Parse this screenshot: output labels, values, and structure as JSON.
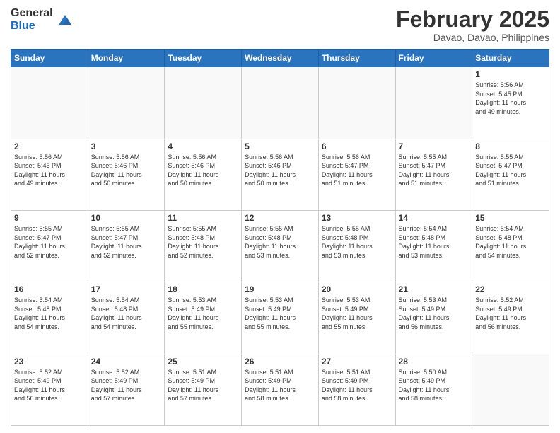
{
  "header": {
    "logo_general": "General",
    "logo_blue": "Blue",
    "month_title": "February 2025",
    "location": "Davao, Davao, Philippines"
  },
  "weekdays": [
    "Sunday",
    "Monday",
    "Tuesday",
    "Wednesday",
    "Thursday",
    "Friday",
    "Saturday"
  ],
  "weeks": [
    [
      {
        "day": "",
        "info": ""
      },
      {
        "day": "",
        "info": ""
      },
      {
        "day": "",
        "info": ""
      },
      {
        "day": "",
        "info": ""
      },
      {
        "day": "",
        "info": ""
      },
      {
        "day": "",
        "info": ""
      },
      {
        "day": "1",
        "info": "Sunrise: 5:56 AM\nSunset: 5:45 PM\nDaylight: 11 hours\nand 49 minutes."
      }
    ],
    [
      {
        "day": "2",
        "info": "Sunrise: 5:56 AM\nSunset: 5:46 PM\nDaylight: 11 hours\nand 49 minutes."
      },
      {
        "day": "3",
        "info": "Sunrise: 5:56 AM\nSunset: 5:46 PM\nDaylight: 11 hours\nand 50 minutes."
      },
      {
        "day": "4",
        "info": "Sunrise: 5:56 AM\nSunset: 5:46 PM\nDaylight: 11 hours\nand 50 minutes."
      },
      {
        "day": "5",
        "info": "Sunrise: 5:56 AM\nSunset: 5:46 PM\nDaylight: 11 hours\nand 50 minutes."
      },
      {
        "day": "6",
        "info": "Sunrise: 5:56 AM\nSunset: 5:47 PM\nDaylight: 11 hours\nand 51 minutes."
      },
      {
        "day": "7",
        "info": "Sunrise: 5:55 AM\nSunset: 5:47 PM\nDaylight: 11 hours\nand 51 minutes."
      },
      {
        "day": "8",
        "info": "Sunrise: 5:55 AM\nSunset: 5:47 PM\nDaylight: 11 hours\nand 51 minutes."
      }
    ],
    [
      {
        "day": "9",
        "info": "Sunrise: 5:55 AM\nSunset: 5:47 PM\nDaylight: 11 hours\nand 52 minutes."
      },
      {
        "day": "10",
        "info": "Sunrise: 5:55 AM\nSunset: 5:47 PM\nDaylight: 11 hours\nand 52 minutes."
      },
      {
        "day": "11",
        "info": "Sunrise: 5:55 AM\nSunset: 5:48 PM\nDaylight: 11 hours\nand 52 minutes."
      },
      {
        "day": "12",
        "info": "Sunrise: 5:55 AM\nSunset: 5:48 PM\nDaylight: 11 hours\nand 53 minutes."
      },
      {
        "day": "13",
        "info": "Sunrise: 5:55 AM\nSunset: 5:48 PM\nDaylight: 11 hours\nand 53 minutes."
      },
      {
        "day": "14",
        "info": "Sunrise: 5:54 AM\nSunset: 5:48 PM\nDaylight: 11 hours\nand 53 minutes."
      },
      {
        "day": "15",
        "info": "Sunrise: 5:54 AM\nSunset: 5:48 PM\nDaylight: 11 hours\nand 54 minutes."
      }
    ],
    [
      {
        "day": "16",
        "info": "Sunrise: 5:54 AM\nSunset: 5:48 PM\nDaylight: 11 hours\nand 54 minutes."
      },
      {
        "day": "17",
        "info": "Sunrise: 5:54 AM\nSunset: 5:48 PM\nDaylight: 11 hours\nand 54 minutes."
      },
      {
        "day": "18",
        "info": "Sunrise: 5:53 AM\nSunset: 5:49 PM\nDaylight: 11 hours\nand 55 minutes."
      },
      {
        "day": "19",
        "info": "Sunrise: 5:53 AM\nSunset: 5:49 PM\nDaylight: 11 hours\nand 55 minutes."
      },
      {
        "day": "20",
        "info": "Sunrise: 5:53 AM\nSunset: 5:49 PM\nDaylight: 11 hours\nand 55 minutes."
      },
      {
        "day": "21",
        "info": "Sunrise: 5:53 AM\nSunset: 5:49 PM\nDaylight: 11 hours\nand 56 minutes."
      },
      {
        "day": "22",
        "info": "Sunrise: 5:52 AM\nSunset: 5:49 PM\nDaylight: 11 hours\nand 56 minutes."
      }
    ],
    [
      {
        "day": "23",
        "info": "Sunrise: 5:52 AM\nSunset: 5:49 PM\nDaylight: 11 hours\nand 56 minutes."
      },
      {
        "day": "24",
        "info": "Sunrise: 5:52 AM\nSunset: 5:49 PM\nDaylight: 11 hours\nand 57 minutes."
      },
      {
        "day": "25",
        "info": "Sunrise: 5:51 AM\nSunset: 5:49 PM\nDaylight: 11 hours\nand 57 minutes."
      },
      {
        "day": "26",
        "info": "Sunrise: 5:51 AM\nSunset: 5:49 PM\nDaylight: 11 hours\nand 58 minutes."
      },
      {
        "day": "27",
        "info": "Sunrise: 5:51 AM\nSunset: 5:49 PM\nDaylight: 11 hours\nand 58 minutes."
      },
      {
        "day": "28",
        "info": "Sunrise: 5:50 AM\nSunset: 5:49 PM\nDaylight: 11 hours\nand 58 minutes."
      },
      {
        "day": "",
        "info": ""
      }
    ]
  ]
}
